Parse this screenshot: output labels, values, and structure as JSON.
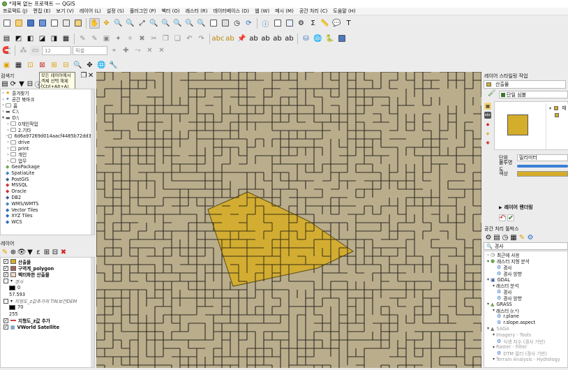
{
  "window": {
    "title": "*제목 없는 프로젝트 — QGIS"
  },
  "menu": [
    "프로젝트 (J)",
    "편집 (E)",
    "보기 (V)",
    "레이어 (L)",
    "설정 (S)",
    "플러그인 (P)",
    "벡터 (O)",
    "래스터 (R)",
    "데이터베이스 (D)",
    "웹 (W)",
    "메시 (M)",
    "공간 처리 (C)",
    "도움말 (H)"
  ],
  "digitize": {
    "spin_value": "12",
    "unit": "픽셀"
  },
  "tooltip": {
    "line1": "모든 레이어에서",
    "line2": "객체 선택 해제",
    "line3": "(Ctrl+Alt+A)"
  },
  "browser": {
    "title": "검색기",
    "items": [
      {
        "label": "즐겨찾기",
        "icon": "star-icon"
      },
      {
        "label": "공간 북마크",
        "icon": "bookmark-icon"
      },
      {
        "label": "홈",
        "icon": "folder-icon"
      },
      {
        "label": "C:\\",
        "icon": "drive-icon"
      },
      {
        "label": "D:\\",
        "icon": "drive-icon"
      },
      {
        "label": "0개인작업",
        "icon": "folder-icon"
      },
      {
        "label": "2.기타",
        "icon": "folder-icon"
      },
      {
        "label": "6d6a97269d014aacf4485b72dd33",
        "icon": "folder-icon"
      },
      {
        "label": "drive",
        "icon": "folder-icon"
      },
      {
        "label": "print",
        "icon": "folder-icon"
      },
      {
        "label": "개인",
        "icon": "folder-icon"
      },
      {
        "label": "업무",
        "icon": "folder-icon"
      },
      {
        "label": "GeoPackage",
        "icon": "geopackage-icon"
      },
      {
        "label": "SpatiaLite",
        "icon": "spatialite-icon"
      },
      {
        "label": "PostGIS",
        "icon": "postgis-icon"
      },
      {
        "label": "MSSQL",
        "icon": "mssql-icon"
      },
      {
        "label": "Oracle",
        "icon": "oracle-icon"
      },
      {
        "label": "DB2",
        "icon": "db2-icon"
      },
      {
        "label": "WMS/WMTS",
        "icon": "wms-icon"
      },
      {
        "label": "Vector Tiles",
        "icon": "vectortiles-icon"
      },
      {
        "label": "XYZ Tiles",
        "icon": "xyz-icon"
      },
      {
        "label": "WCS",
        "icon": "wcs-icon"
      }
    ]
  },
  "layers": {
    "title": "레이어",
    "items": [
      {
        "label": "산출물",
        "checked": true,
        "color": "#d4ad2a",
        "kind": "poly"
      },
      {
        "label": "구역계_polygon",
        "checked": true,
        "color": "#a06a5a",
        "kind": "poly"
      },
      {
        "label": "벡터화한 산출물",
        "checked": true,
        "color": "#ecd9c4",
        "kind": "poly"
      },
      {
        "label": "경사",
        "checked": false,
        "kind": "raster"
      },
      {
        "label": "0",
        "kind": "legend",
        "color": "#000000"
      },
      {
        "label": "57.593",
        "kind": "legend-text"
      },
      {
        "label": "지형도_z값추가의 TIN보간DEM",
        "checked": false,
        "kind": "raster"
      },
      {
        "label": "70",
        "kind": "legend",
        "color": "#000000"
      },
      {
        "label": "255",
        "kind": "legend-text"
      },
      {
        "label": "지형도_z값 추가",
        "checked": true,
        "color": "#c44",
        "kind": "line"
      },
      {
        "label": "VWorld Satellite",
        "checked": true,
        "kind": "tile"
      }
    ]
  },
  "style_panel": {
    "title": "레이어 스타일링 작업",
    "layer_select": "산출물",
    "renderer": "단일 심볼",
    "fill_label": "채",
    "unit_label": "단위",
    "unit_value": "밀리미터",
    "opacity_label": "불투명도",
    "color_label": "색상",
    "fill_color": "#d4ad2a",
    "rendering_label": "레이어 렌더링"
  },
  "processing": {
    "title": "공간 처리 툴박스",
    "search_placeholder": "경사",
    "items": [
      {
        "label": "최근에 사용",
        "indent": 0,
        "icon": "clock-icon"
      },
      {
        "label": "래스터 지형 분석",
        "indent": 0,
        "icon": "qgis-icon"
      },
      {
        "label": "경사",
        "indent": 2,
        "icon": "gear-icon"
      },
      {
        "label": "경사 방향",
        "indent": 2,
        "icon": "gear-icon"
      },
      {
        "label": "GDAL",
        "indent": 0,
        "icon": "gdal-icon"
      },
      {
        "label": "래스터 분석",
        "indent": 1,
        "icon": "none"
      },
      {
        "label": "경사",
        "indent": 2,
        "icon": "gear-icon"
      },
      {
        "label": "경사 방향",
        "indent": 2,
        "icon": "gear-icon"
      },
      {
        "label": "GRASS",
        "indent": 0,
        "icon": "grass-icon"
      },
      {
        "label": "래스터 (r.*)",
        "indent": 1,
        "icon": "none"
      },
      {
        "label": "r.plane",
        "indent": 2,
        "icon": "gear-icon"
      },
      {
        "label": "r.slope.aspect",
        "indent": 2,
        "icon": "gear-icon"
      },
      {
        "label": "SAGA",
        "indent": 0,
        "icon": "saga-icon"
      },
      {
        "label": "Imagery - Tools",
        "indent": 1,
        "icon": "none"
      },
      {
        "label": "식생 지수 (경사 기반)",
        "indent": 2,
        "icon": "gear-icon"
      },
      {
        "label": "Raster - Filter",
        "indent": 1,
        "icon": "none"
      },
      {
        "label": "DTM 필터 (경사 기반)",
        "indent": 2,
        "icon": "gear-icon"
      },
      {
        "label": "Terrain Analysis - Hydrology",
        "indent": 1,
        "icon": "none"
      }
    ]
  }
}
